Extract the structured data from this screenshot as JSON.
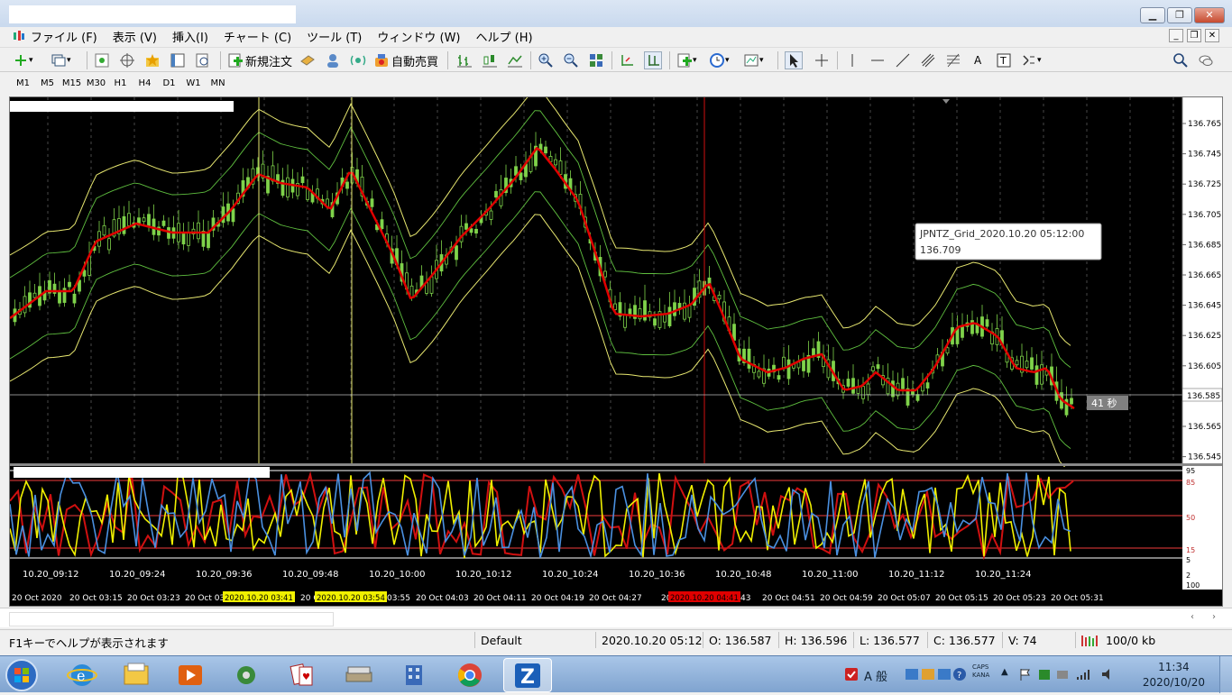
{
  "menu": {
    "items": [
      "ファイル (F)",
      "表示 (V)",
      "挿入(I)",
      "チャート (C)",
      "ツール (T)",
      "ウィンドウ (W)",
      "ヘルプ (H)"
    ]
  },
  "toolbar": {
    "new_order_label": "新規注文",
    "autotrade_label": "自動売買",
    "font_a": "A"
  },
  "timeframes": [
    "M1",
    "M5",
    "M15",
    "M30",
    "H1",
    "H4",
    "D1",
    "W1",
    "MN"
  ],
  "chart": {
    "price_ticks": [
      "136.765",
      "136.745",
      "136.725",
      "136.705",
      "136.685",
      "136.665",
      "136.645",
      "136.625",
      "136.605",
      "136.585",
      "136.565",
      "136.545"
    ],
    "current_price": "136.585",
    "countdown": "41 秒",
    "tooltip_title": "JPNTZ_Grid_2020.10.20 05:12:00",
    "tooltip_value": "136.709",
    "sub_ticks": [
      "95",
      "85",
      "50",
      "15",
      "5",
      "2",
      "100"
    ],
    "grid_time_labels": [
      "10.20_09:12",
      "10.20_09:24",
      "10.20_09:36",
      "10.20_09:48",
      "10.20_10:00",
      "10.20_10:12",
      "10.20_10:24",
      "10.20_10:36",
      "10.20_10:48",
      "10.20_11:00",
      "10.20_11:12",
      "10.20_11:24"
    ],
    "time_axis": [
      "20 Oct 2020",
      "20 Oct 03:15",
      "20 Oct 03:23",
      "20 Oct 03",
      "20 C",
      "03:55",
      "20 Oct 04:03",
      "20 Oct 04:11",
      "20 Oct 04:19",
      "20 Oct 04:27",
      "20 Oct",
      "43",
      "20 Oct 04:51",
      "20 Oct 04:59",
      "20 Oct 05:07",
      "20 Oct 05:15",
      "20 Oct 05:23",
      "20 Oct 05:31"
    ],
    "time_highlights": {
      "yellow1": "2020.10.20 03:41",
      "yellow2": "2020.10.20 03:54",
      "red": "2020.10.20 04:41"
    },
    "colors": {
      "candle": "#7fd34a",
      "ma": "#e00000",
      "band_outer": "#e8e870",
      "band_inner": "#5fbf3f",
      "stoch_blue": "#4a90e0",
      "stoch_yellow": "#f0f000",
      "stoch_red": "#d01010"
    }
  },
  "status": {
    "help": "F1キーでヘルプが表示されます",
    "profile": "Default",
    "datetime": "2020.10.20 05:12",
    "open": "O: 136.587",
    "high": "H: 136.596",
    "low": "L: 136.577",
    "close": "C: 136.577",
    "volume": "V: 74",
    "traffic": "100/0 kb"
  },
  "tray": {
    "ime": "A 般",
    "caps": "CAPS",
    "kana": "KANA",
    "time": "11:34",
    "date": "2020/10/20"
  }
}
